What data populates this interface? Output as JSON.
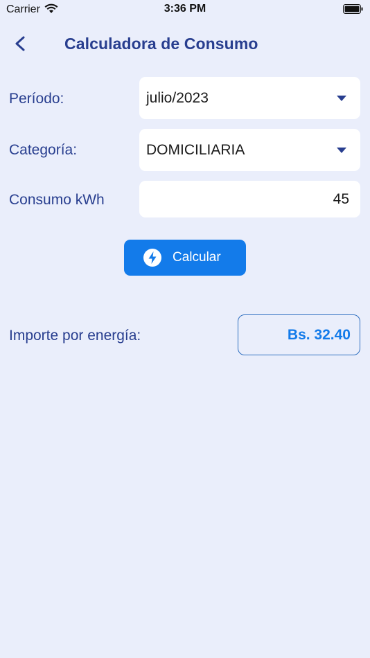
{
  "status_bar": {
    "carrier": "Carrier",
    "time": "3:36 PM"
  },
  "header": {
    "title": "Calculadora de Consumo",
    "back_icon": "chevron-left-icon"
  },
  "form": {
    "period": {
      "label": "Período:",
      "value": "julio/2023"
    },
    "category": {
      "label": "Categoría:",
      "value": "DOMICILIARIA"
    },
    "consumption": {
      "label": "Consumo kWh",
      "value": "45"
    }
  },
  "calculate_button": {
    "label": "Calcular",
    "icon": "lightning-bolt-icon"
  },
  "result": {
    "label": "Importe por energía:",
    "value": "Bs. 32.40"
  },
  "colors": {
    "background": "#EAEEFB",
    "primary_text": "#283E8F",
    "accent": "#137BEA",
    "field_background": "#FFFFFF"
  }
}
